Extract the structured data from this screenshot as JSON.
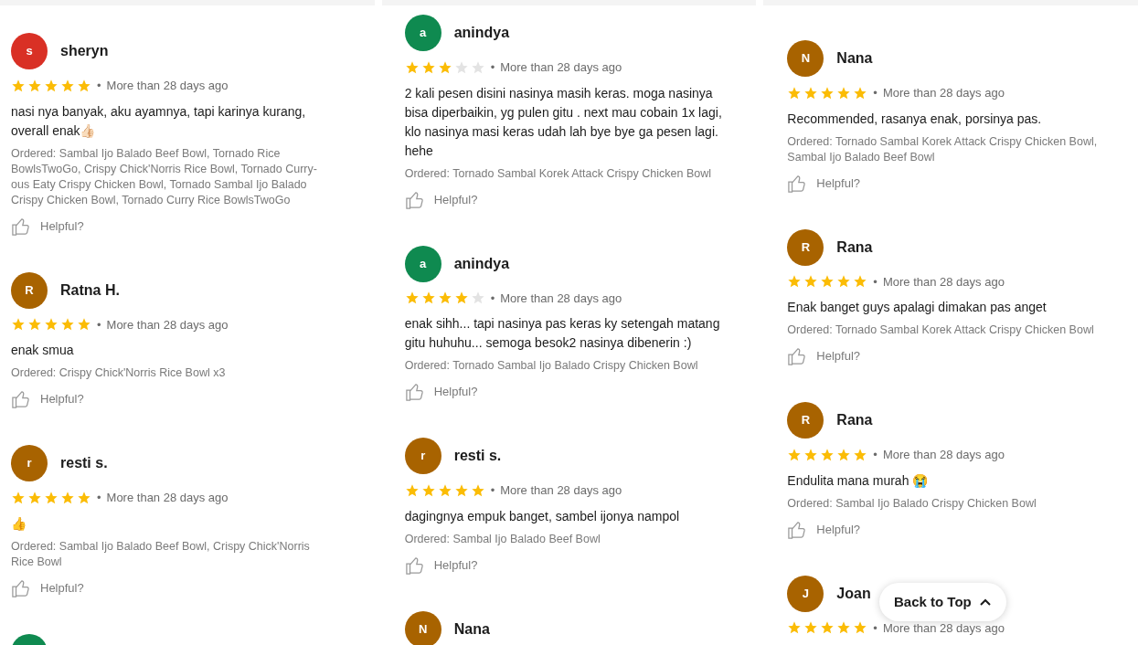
{
  "columns": [
    {
      "reviews": [
        {
          "avatar_letter": "s",
          "color": "#d93025",
          "name": "sheryn",
          "stars": 5,
          "dot": "•",
          "time": "More than 28 days ago",
          "comment": "nasi nya banyak, aku ayamnya, tapi karinya kurang, overall enak👍🏻",
          "ordered": "Ordered: Sambal Ijo Balado Beef Bowl, Tornado Rice BowlsTwoGo, Crispy Chick'Norris Rice Bowl, Tornado Curry-ous Eaty Crispy Chicken Bowl, Tornado Sambal Ijo Balado Crispy Chicken Bowl, Tornado Curry Rice BowlsTwoGo",
          "helpful": "Helpful?"
        },
        {
          "avatar_letter": "R",
          "color": "#a86300",
          "name": "Ratna H.",
          "stars": 5,
          "dot": "•",
          "time": "More than 28 days ago",
          "comment": "enak smua",
          "ordered": "Ordered: Crispy Chick'Norris Rice Bowl x3",
          "helpful": "Helpful?"
        },
        {
          "avatar_letter": "r",
          "color": "#a86300",
          "name": "resti s.",
          "stars": 5,
          "dot": "•",
          "time": "More than 28 days ago",
          "comment": "👍",
          "ordered": "Ordered: Sambal Ijo Balado Beef Bowl, Crispy Chick'Norris Rice Bowl",
          "helpful": "Helpful?"
        },
        {
          "color": "#0f8a50"
        }
      ]
    },
    {
      "reviews": [
        {
          "avatar_letter": "a",
          "color": "#0f8a50",
          "name": "anindya",
          "stars": 3,
          "dot": "•",
          "time": "More than 28 days ago",
          "comment": "2 kali pesen disini nasinya masih keras. moga nasinya bisa diperbaikin, yg pulen gitu . next mau cobain 1x lagi, klo nasinya masi keras udah lah bye bye ga pesen lagi. hehe",
          "ordered": "Ordered: Tornado Sambal Korek Attack Crispy Chicken Bowl",
          "helpful": "Helpful?"
        },
        {
          "avatar_letter": "a",
          "color": "#0f8a50",
          "name": "anindya",
          "stars": 4,
          "dot": "•",
          "time": "More than 28 days ago",
          "comment": "enak sihh... tapi nasinya pas keras ky setengah matang gitu huhuhu... semoga besok2 nasinya dibenerin :)",
          "ordered": "Ordered: Tornado Sambal Ijo Balado Crispy Chicken Bowl",
          "helpful": "Helpful?"
        },
        {
          "avatar_letter": "r",
          "color": "#a86300",
          "name": "resti s.",
          "stars": 5,
          "dot": "•",
          "time": "More than 28 days ago",
          "comment": "dagingnya empuk banget, sambel ijonya  nampol",
          "ordered": "Ordered: Sambal Ijo Balado Beef Bowl",
          "helpful": "Helpful?"
        },
        {
          "avatar_letter": "N",
          "color": "#a86300",
          "name": "Nana"
        }
      ]
    },
    {
      "reviews": [
        {
          "avatar_letter": "N",
          "color": "#a86300",
          "name": "Nana",
          "stars": 5,
          "dot": "•",
          "time": "More than 28 days ago",
          "comment": "Recommended, rasanya enak, porsinya pas.",
          "ordered": "Ordered: Tornado Sambal Korek Attack Crispy Chicken Bowl, Sambal Ijo Balado Beef Bowl",
          "helpful": "Helpful?"
        },
        {
          "avatar_letter": "R",
          "color": "#a86300",
          "name": "Rana",
          "stars": 5,
          "dot": "•",
          "time": "More than 28 days ago",
          "comment": "Enak banget guys apalagi dimakan pas anget",
          "ordered": "Ordered: Tornado Sambal Korek Attack Crispy Chicken Bowl",
          "helpful": "Helpful?"
        },
        {
          "avatar_letter": "R",
          "color": "#a86300",
          "name": "Rana",
          "stars": 5,
          "dot": "•",
          "time": "More than 28 days ago",
          "comment": "Endulita mana murah 😭",
          "ordered": "Ordered: Sambal Ijo Balado Crispy Chicken Bowl",
          "helpful": "Helpful?"
        },
        {
          "avatar_letter": "J",
          "color": "#a86300",
          "name": "Joan",
          "stars": 5,
          "dot": "•",
          "time": "More than 28 days ago"
        }
      ]
    }
  ],
  "back_to_top": {
    "label": "Back to Top"
  }
}
